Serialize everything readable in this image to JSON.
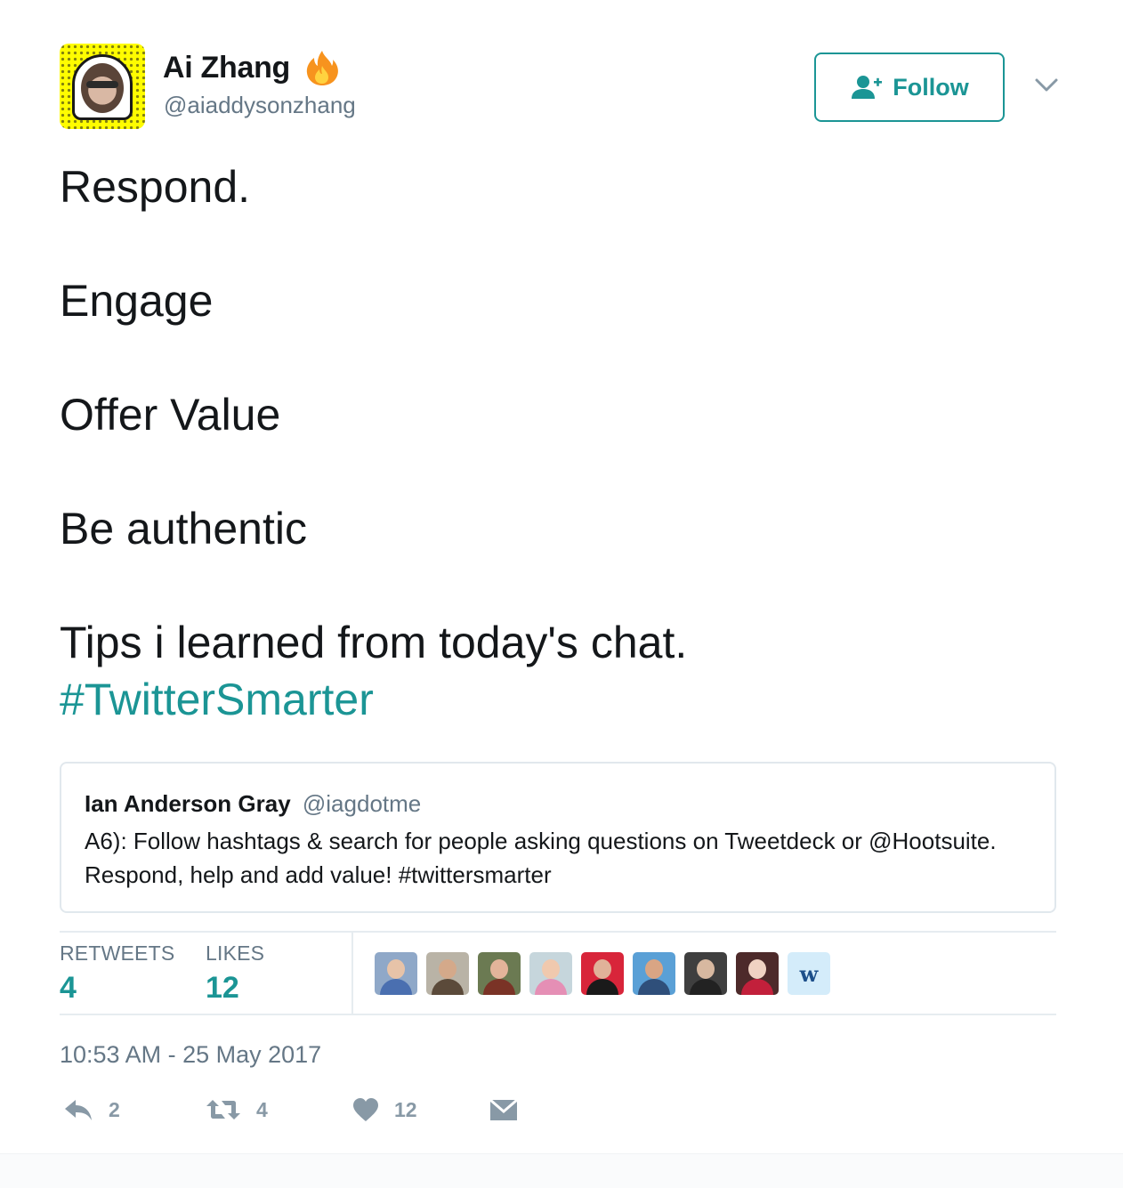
{
  "author": {
    "name": "Ai Zhang",
    "handle": "@aiaddysonzhang",
    "avatar_icon": "snapcode-avatar-icon",
    "badge_icon": "fire-emoji-icon"
  },
  "follow_button": {
    "label": "Follow",
    "icon": "follow-user-plus-icon",
    "color": "#1b9595"
  },
  "menu_icon": "chevron-down-icon",
  "tweet": {
    "lines": [
      "Respond.",
      "Engage",
      "Offer Value",
      "Be authentic",
      "Tips i learned from today's chat."
    ],
    "hashtag": "#TwitterSmarter"
  },
  "quoted_tweet": {
    "name": "Ian Anderson Gray",
    "handle": "@iagdotme",
    "text": "A6): Follow hashtags & search for people asking questions on Tweetdeck or @Hootsuite. Respond, help and add value! #twittersmarter"
  },
  "stats": {
    "retweets_label": "RETWEETS",
    "retweets_value": "4",
    "likes_label": "LIKES",
    "likes_value": "12"
  },
  "likers": [
    {
      "name": "liker-avatar-1"
    },
    {
      "name": "liker-avatar-2"
    },
    {
      "name": "liker-avatar-3"
    },
    {
      "name": "liker-avatar-4"
    },
    {
      "name": "liker-avatar-5"
    },
    {
      "name": "liker-avatar-6"
    },
    {
      "name": "liker-avatar-7"
    },
    {
      "name": "liker-avatar-8"
    },
    {
      "name": "liker-avatar-9",
      "letter": "w"
    }
  ],
  "timestamp": "10:53 AM - 25 May 2017",
  "actions": {
    "reply_count": "2",
    "retweet_count": "4",
    "like_count": "12",
    "reply_icon": "reply-icon",
    "retweet_icon": "retweet-icon",
    "like_icon": "heart-icon",
    "dm_icon": "direct-message-icon"
  },
  "colors": {
    "accent": "#1b9595",
    "text": "#14171a",
    "secondary": "#657786",
    "border": "#e1e8ed"
  }
}
